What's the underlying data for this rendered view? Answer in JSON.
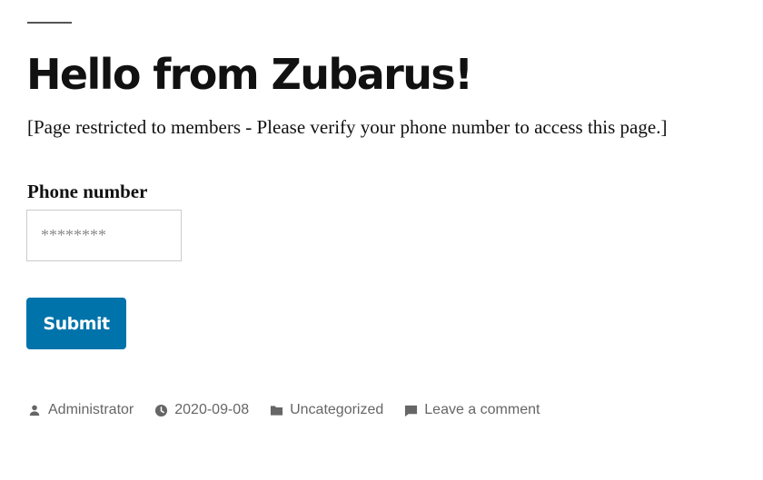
{
  "post": {
    "title": "Hello from Zubarus!",
    "restriction_notice": "[Page restricted to members - Please verify your phone number to access this page.]"
  },
  "form": {
    "phone_label": "Phone number",
    "phone_placeholder": "********",
    "phone_value": "",
    "submit_label": "Submit"
  },
  "meta": {
    "author": "Administrator",
    "date": "2020-09-08",
    "category": "Uncategorized",
    "comment_link": "Leave a comment",
    "icons": [
      "person-icon",
      "clock-icon",
      "folder-icon",
      "comment-icon"
    ]
  },
  "colors": {
    "accent": "#0073aa",
    "text": "#111111",
    "meta_text": "#666666",
    "rule": "#555555"
  }
}
